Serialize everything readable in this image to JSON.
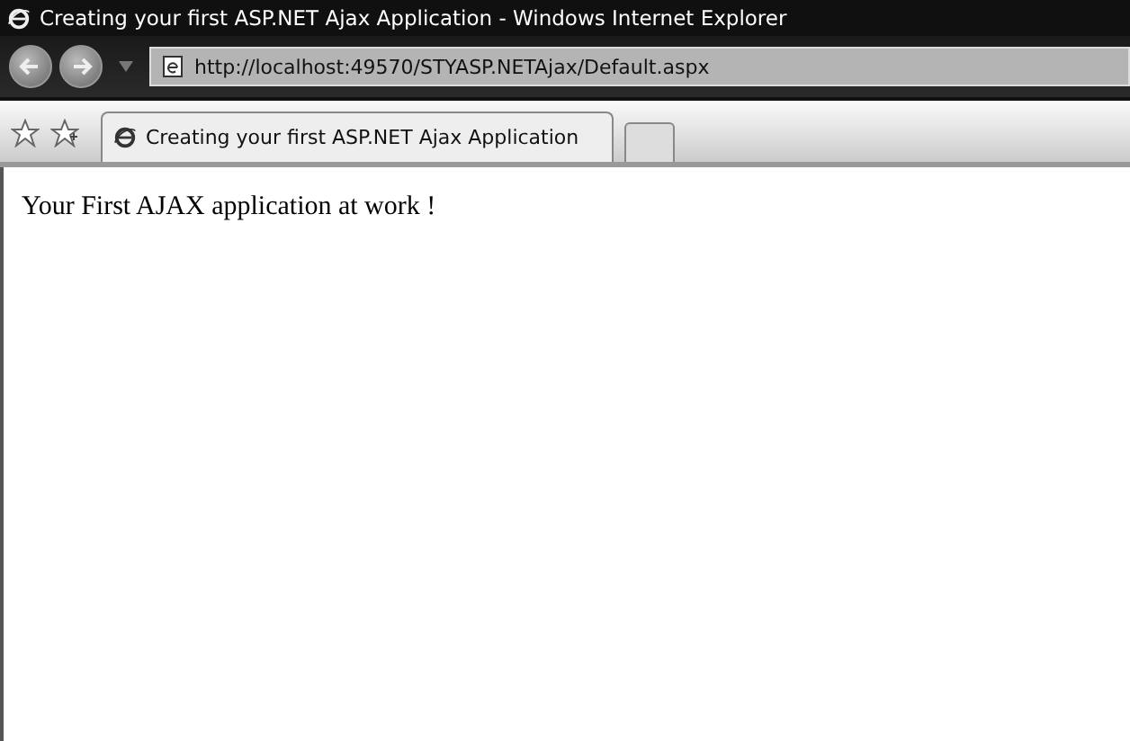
{
  "window": {
    "title": "Creating your first ASP.NET Ajax Application - Windows Internet Explorer"
  },
  "address_bar": {
    "value": "http://localhost:49570/STYASP.NETAjax/Default.aspx"
  },
  "tabs": [
    {
      "label": "Creating your first ASP.NET Ajax Application",
      "selected": true
    }
  ],
  "page": {
    "text": "Your First AJAX application at work !"
  }
}
